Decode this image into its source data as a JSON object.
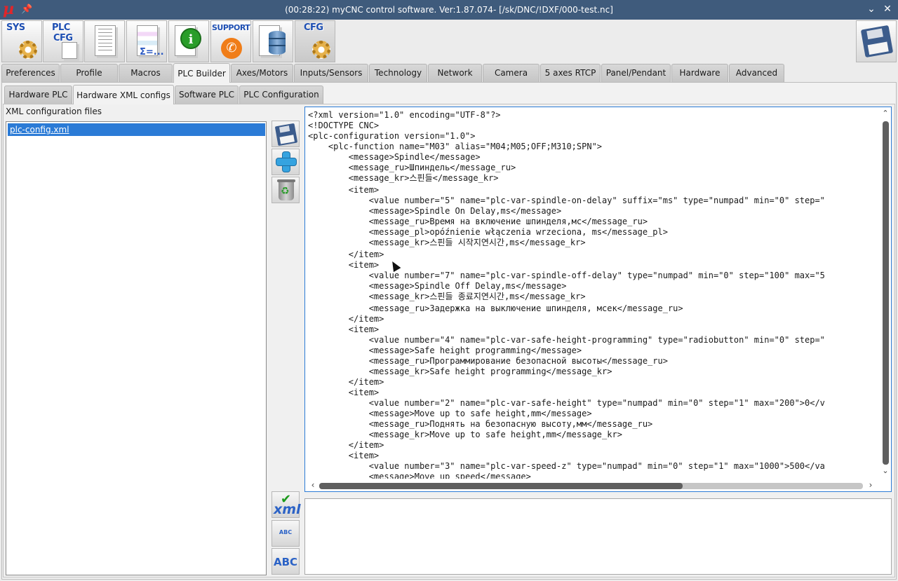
{
  "window": {
    "logo": "µ",
    "title": "(00:28:22)  myCNC control software. Ver:1.87.074-   [/sk/DNC/!DXF/000-test.nc]"
  },
  "toolbar": {
    "sys_label": "SYS",
    "plc_cfg_label_1": "PLC",
    "plc_cfg_label_2": "CFG",
    "support_label": "SUPPORT",
    "sigma_label": "Σ=...",
    "info_label": "i",
    "cfg_label": "CFG"
  },
  "main_tabs": [
    {
      "label": "Preferences"
    },
    {
      "label": "Profile"
    },
    {
      "label": "Macros"
    },
    {
      "label": "PLC Builder"
    },
    {
      "label": "Axes/Motors"
    },
    {
      "label": "Inputs/Sensors"
    },
    {
      "label": "Technology"
    },
    {
      "label": "Network"
    },
    {
      "label": "Camera"
    },
    {
      "label": "5 axes RTCP"
    },
    {
      "label": "Panel/Pendant"
    },
    {
      "label": "Hardware"
    },
    {
      "label": "Advanced"
    }
  ],
  "sub_tabs": [
    {
      "label": "Hardware PLC"
    },
    {
      "label": "Hardware XML configs"
    },
    {
      "label": "Software PLC"
    },
    {
      "label": "PLC Configuration"
    }
  ],
  "files": {
    "section_label": "XML configuration files",
    "items": [
      {
        "name": "plc-config.xml"
      }
    ]
  },
  "side_buttons": {
    "abc_small": "ABC",
    "abc_big": "ABC",
    "xml_label": "xml"
  },
  "editor": {
    "lines": [
      "<?xml version=\"1.0\" encoding=\"UTF-8\"?>",
      "<!DOCTYPE CNC>",
      "<plc-configuration version=\"1.0\">",
      "    <plc-function name=\"M03\" alias=\"M04;M05;OFF;M310;SPN\">",
      "        <message>Spindle</message>",
      "        <message_ru>Шпиндель</message_ru>",
      "        <message_kr>스핀들</message_kr>",
      "        <item>",
      "            <value number=\"5\" name=\"plc-var-spindle-on-delay\" suffix=\"ms\" type=\"numpad\" min=\"0\" step=\"",
      "            <message>Spindle On Delay,ms</message>",
      "            <message_ru>Время на включение шпинделя,мс</message_ru>",
      "            <message_pl>opóźnienie włączenia wrzeciona, ms</message_pl>",
      "            <message_kr>스핀들 시작지연시간,ms</message_kr>",
      "        </item>",
      "        <item>",
      "            <value number=\"7\" name=\"plc-var-spindle-off-delay\" type=\"numpad\" min=\"0\" step=\"100\" max=\"5",
      "            <message>Spindle Off Delay,ms</message>",
      "            <message_kr>스핀들 종료지연시간,ms</message_kr>",
      "            <message_ru>Задержка на выключение шпинделя, мсек</message_ru>",
      "        </item>",
      "        <item>",
      "            <value number=\"4\" name=\"plc-var-safe-height-programming\" type=\"radiobutton\" min=\"0\" step=\"",
      "            <message>Safe height programming</message>",
      "            <message_ru>Программирование безопасной высоты</message_ru>",
      "            <message_kr>Safe height programming</message_kr>",
      "        </item>",
      "        <item>",
      "            <value number=\"2\" name=\"plc-var-safe-height\" type=\"numpad\" min=\"0\" step=\"1\" max=\"200\">0</v",
      "            <message>Move up to safe height,mm</message>",
      "            <message_ru>Поднять на безопасную высоту,мм</message_ru>",
      "            <message_kr>Move up to safe height,mm</message_kr>",
      "        </item>",
      "        <item>",
      "            <value number=\"3\" name=\"plc-var-speed-z\" type=\"numpad\" min=\"0\" step=\"1\" max=\"1000\">500</va",
      "            <message>Move up speed</message>"
    ]
  },
  "output": {
    "text": ""
  }
}
